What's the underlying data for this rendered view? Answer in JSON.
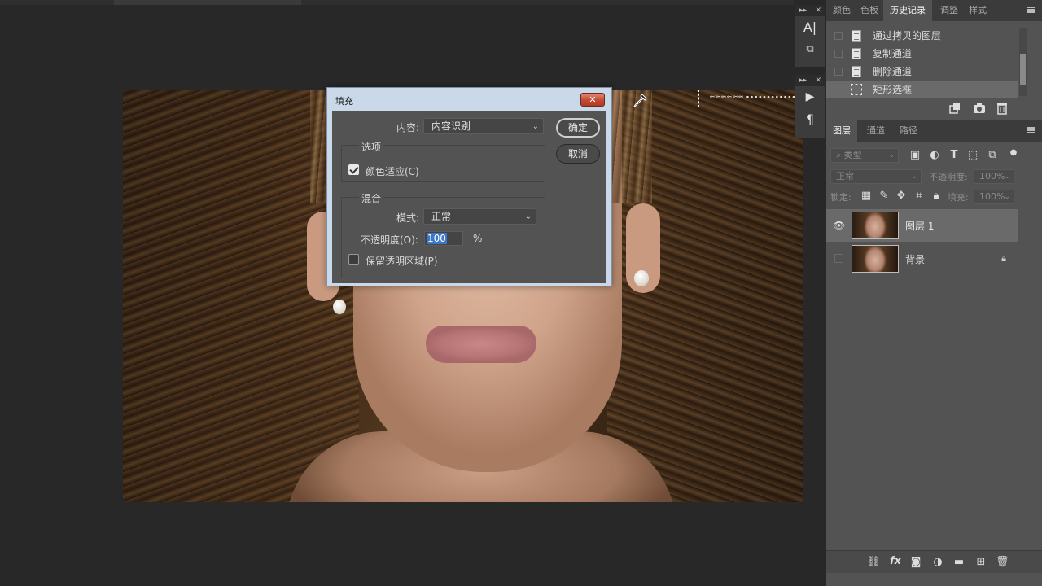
{
  "dialog": {
    "title": "填充",
    "close_symbol": "✕",
    "content_label": "内容:",
    "content_value": "内容识别",
    "ok_label": "确定",
    "cancel_label": "取消",
    "options_group": "选项",
    "color_adapt_label": "颜色适应(C)",
    "color_adapt_checked": true,
    "blend_group": "混合",
    "mode_label": "模式:",
    "mode_value": "正常",
    "opacity_label": "不透明度(O):",
    "opacity_value": "100",
    "percent": "%",
    "preserve_label": "保留透明区域(P)",
    "preserve_checked": false
  },
  "mini_panels": {
    "collapse_symbol": "▸▸",
    "close_symbol": "✕",
    "icon_char_a": "A|",
    "icon_play": "▶",
    "icon_para": "¶"
  },
  "top_panel": {
    "tabs": [
      "颜色",
      "色板",
      "历史记录",
      "调整",
      "样式"
    ],
    "active_tab": 2,
    "history": [
      {
        "label": "通过拷贝的图层",
        "icon": "document-icon"
      },
      {
        "label": "复制通道",
        "icon": "document-icon"
      },
      {
        "label": "删除通道",
        "icon": "document-icon"
      },
      {
        "label": "矩形选框",
        "icon": "marquee-icon"
      }
    ],
    "selected_history": 3
  },
  "layers_panel": {
    "tabs": [
      "图层",
      "通道",
      "路径"
    ],
    "active_tab": 0,
    "filter_placeholder": "类型",
    "blend_mode": "正常",
    "opacity_label": "不透明度:",
    "opacity_value": "100%",
    "lock_label": "锁定:",
    "fill_label": "填充:",
    "fill_value": "100%",
    "layers": [
      {
        "name": "图层 1",
        "visible": true,
        "locked": false,
        "selected": true
      },
      {
        "name": "背景",
        "visible": false,
        "locked": true,
        "selected": false
      }
    ]
  },
  "colors": {
    "dialog_frame": "#c9d9ea",
    "dialog_body": "#535353",
    "close_button": "#c24a33",
    "highlight": "#3b78c8",
    "app_bg": "#282828",
    "panel_bg": "#535353"
  }
}
